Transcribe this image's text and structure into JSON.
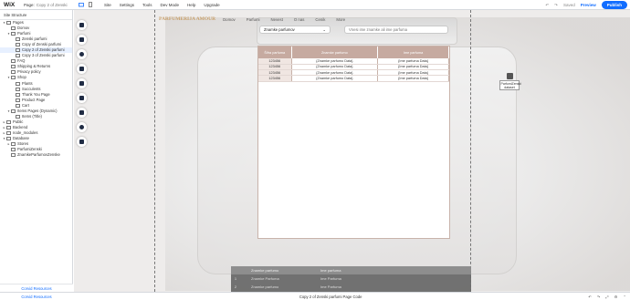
{
  "topbar": {
    "logo": "WiX",
    "page_label": "Page:",
    "page_value": "Copy 2 of Zenski...",
    "menu": [
      "Site",
      "Settings",
      "Tools",
      "Dev Mode",
      "Help",
      "Upgrade"
    ],
    "undo": "Saved",
    "preview": "Preview",
    "publish": "Publish"
  },
  "sidebar": {
    "title": "Site Structure",
    "items": [
      {
        "label": "Pages",
        "level": 0,
        "arrow": "▾"
      },
      {
        "label": "Domov",
        "level": 1,
        "arrow": ""
      },
      {
        "label": "Parfumi",
        "level": 1,
        "arrow": "▾"
      },
      {
        "label": "Zenski parfumi",
        "level": 2,
        "arrow": ""
      },
      {
        "label": "Copy of Zenski parfumi",
        "level": 2,
        "arrow": ""
      },
      {
        "label": "Copy 2 of Zenski parfumi",
        "level": 2,
        "arrow": "",
        "active": true
      },
      {
        "label": "Copy 3 of Zenski parfumi",
        "level": 2,
        "arrow": ""
      },
      {
        "label": "FAQ",
        "level": 1,
        "arrow": ""
      },
      {
        "label": "Shipping & Returns",
        "level": 1,
        "arrow": ""
      },
      {
        "label": "Privacy policy",
        "level": 1,
        "arrow": ""
      },
      {
        "label": "Shop",
        "level": 1,
        "arrow": "▾"
      },
      {
        "label": "Plants",
        "level": 2,
        "arrow": ""
      },
      {
        "label": "Succulents",
        "level": 2,
        "arrow": ""
      },
      {
        "label": "Thank You Page",
        "level": 2,
        "arrow": ""
      },
      {
        "label": "Product Page",
        "level": 2,
        "arrow": ""
      },
      {
        "label": "Cart",
        "level": 2,
        "arrow": ""
      },
      {
        "label": "Items Pages (Dynamic)",
        "level": 1,
        "arrow": "▾"
      },
      {
        "label": "Items (Title)",
        "level": 2,
        "arrow": ""
      },
      {
        "label": "Public",
        "level": 0,
        "arrow": "▸"
      },
      {
        "label": "Backend",
        "level": 0,
        "arrow": "▸"
      },
      {
        "label": "node_modules",
        "level": 0,
        "arrow": "▸"
      },
      {
        "label": "Database",
        "level": 0,
        "arrow": "▾"
      },
      {
        "label": "Stores",
        "level": 1,
        "arrow": "▸"
      },
      {
        "label": "ParfumiZenski",
        "level": 1,
        "arrow": ""
      },
      {
        "label": "ZnamkeParfumovZenske",
        "level": 1,
        "arrow": ""
      }
    ],
    "footer": "Corvid Resources"
  },
  "site": {
    "logo": "PARFUMERIJA AMOUR",
    "nav": [
      "Domov",
      "Parfumi",
      "Nevest",
      "O nas",
      "Cenik",
      "More"
    ],
    "dropdown": "Znamke parfumov",
    "search_placeholder": "Vnesi ime znamke ali ime parfuma"
  },
  "table": {
    "headers": [
      "Šifra parfuma",
      "Znamke parfumo",
      "Ime parfuma"
    ],
    "rows": [
      [
        "123456",
        "{Znamke parfumo Data}",
        "{Ime parfuma Data}"
      ],
      [
        "123456",
        "{Znamke parfumo Data}",
        "{Ime parfuma Data}"
      ],
      [
        "123456",
        "{Znamke parfumo Data}",
        "{Ime parfuma Data}"
      ],
      [
        "123456",
        "{Znamke parfumo Data}",
        "{Ime parfuma Data}"
      ]
    ]
  },
  "dataset": {
    "label": "ParfumiZenski dataset"
  },
  "footer_strip": {
    "header": [
      "Znamke parfumo",
      "Ime parfuma"
    ],
    "rows": [
      [
        "1",
        "Znamke Parfuma",
        "Ime Parfuma"
      ],
      [
        "2",
        "Znamke parfumo",
        "Ime Parfuma"
      ]
    ]
  },
  "bottombar": {
    "left": "Corvid Resources",
    "center": "Copy 2 of Zenski parfumi Page Code"
  }
}
